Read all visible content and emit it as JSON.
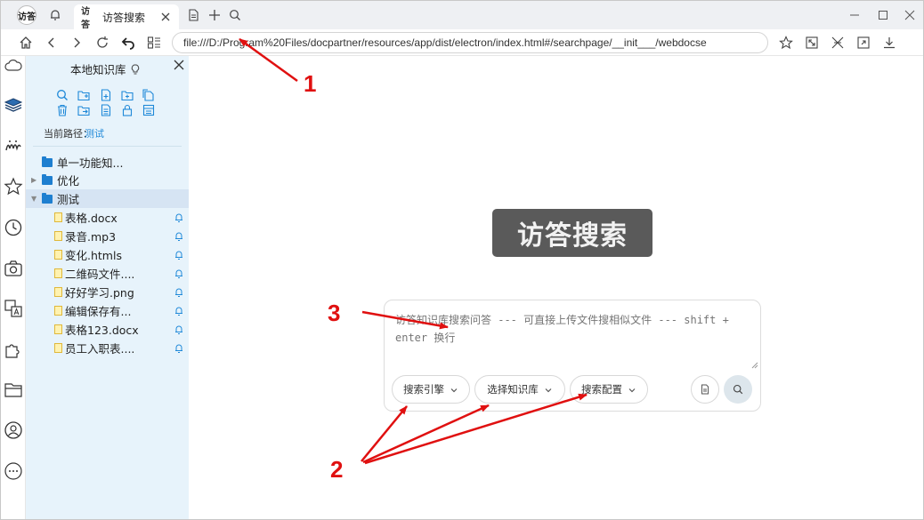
{
  "tab": {
    "favicon_text": "访答",
    "title": "访答搜索"
  },
  "app_logo_text": "访答",
  "address_bar": {
    "url": "file:///D:/Program%20Files/docpartner/resources/app/dist/electron/index.html#/searchpage/__init___/webdocse"
  },
  "panel": {
    "title": "本地知识库",
    "current_path_label": "当前路径：",
    "current_path_value": "测试",
    "tree": [
      {
        "type": "folder",
        "label": "单一功能知...",
        "expanded": false,
        "has_caret": false
      },
      {
        "type": "folder",
        "label": "优化",
        "expanded": false,
        "has_caret": true
      },
      {
        "type": "folder",
        "label": "测试",
        "expanded": true,
        "has_caret": true,
        "selected": true
      },
      {
        "type": "file",
        "label": "表格.docx"
      },
      {
        "type": "file",
        "label": "录音.mp3"
      },
      {
        "type": "file",
        "label": "变化.htmls"
      },
      {
        "type": "file",
        "label": "二维码文件...."
      },
      {
        "type": "file",
        "label": "好好学习.png"
      },
      {
        "type": "file",
        "label": "编辑保存有..."
      },
      {
        "type": "file",
        "label": "表格123.docx"
      },
      {
        "type": "file",
        "label": "员工入职表...."
      }
    ]
  },
  "main": {
    "logo_text": "访答搜索",
    "search_placeholder": "访答知识库搜索问答 --- 可直接上传文件搜相似文件 --- shift + enter 换行",
    "dropdowns": [
      {
        "label": "搜索引擎"
      },
      {
        "label": "选择知识库"
      },
      {
        "label": "搜索配置"
      }
    ]
  },
  "annotations": {
    "label_1": "1",
    "label_2": "2",
    "label_3": "3",
    "color": "#e01010"
  }
}
